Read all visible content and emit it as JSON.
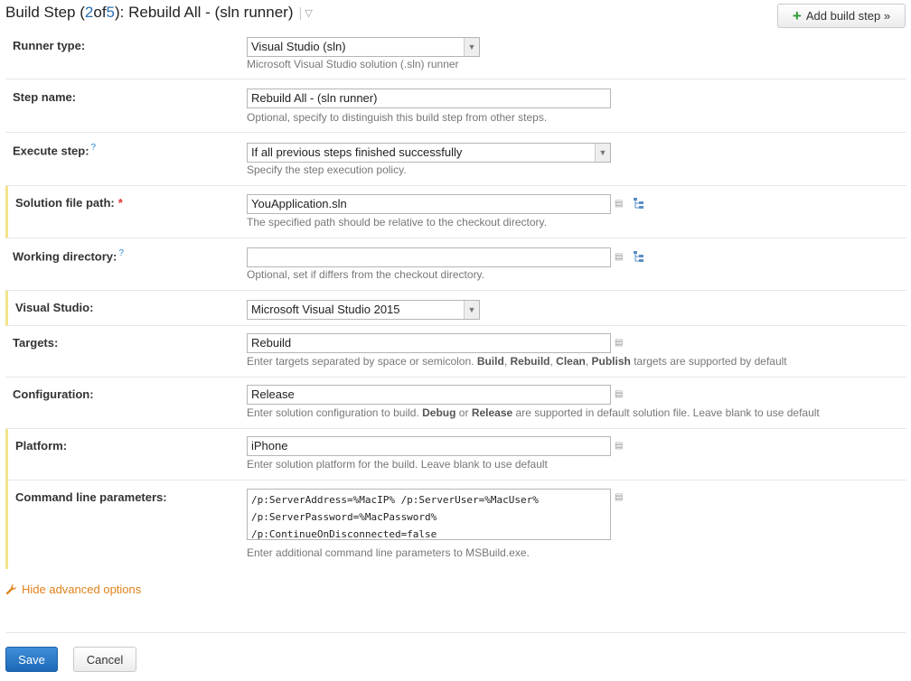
{
  "header": {
    "prefix": "Build Step (",
    "current": "2",
    "of": " of ",
    "total": "5",
    "suffix": "): Rebuild All - (sln runner)",
    "add_button": "Add build step »"
  },
  "fields": {
    "runner_type": {
      "label": "Runner type:",
      "value": "Visual Studio (sln)",
      "note": "Microsoft Visual Studio solution (.sln) runner"
    },
    "step_name": {
      "label": "Step name:",
      "value": "Rebuild All - (sln runner)",
      "note": "Optional, specify to distinguish this build step from other steps."
    },
    "execute_step": {
      "label": "Execute step:",
      "value": "If all previous steps finished successfully",
      "note": "Specify the step execution policy."
    },
    "solution_path": {
      "label": "Solution file path:",
      "required": "*",
      "value": "YouApplication.sln",
      "note": "The specified path should be relative to the checkout directory."
    },
    "working_dir": {
      "label": "Working directory:",
      "value": "",
      "note": "Optional, set if differs from the checkout directory."
    },
    "visual_studio": {
      "label": "Visual Studio:",
      "value": "Microsoft Visual Studio 2015"
    },
    "targets": {
      "label": "Targets:",
      "value": "Rebuild",
      "note_pre": "Enter targets separated by space or semicolon. ",
      "note_b1": "Build",
      "note_c1": ", ",
      "note_b2": "Rebuild",
      "note_c2": ", ",
      "note_b3": "Clean",
      "note_c3": ", ",
      "note_b4": "Publish",
      "note_post": " targets are supported by default"
    },
    "configuration": {
      "label": "Configuration:",
      "value": "Release",
      "note_pre": "Enter solution configuration to build. ",
      "note_b1": "Debug",
      "note_mid": " or ",
      "note_b2": "Release",
      "note_post": " are supported in default solution file. Leave blank to use default"
    },
    "platform": {
      "label": "Platform:",
      "value": "iPhone",
      "note": "Enter solution platform for the build. Leave blank to use default"
    },
    "cmdline": {
      "label": "Command line parameters:",
      "line1": "/p:ServerAddress=%MacIP% /p:ServerUser=%MacUser%",
      "line2": "/p:ServerPassword=%MacPassword%",
      "line3": "/p:ContinueOnDisconnected=false",
      "note": "Enter additional command line parameters to MSBuild.exe."
    }
  },
  "help_glyph": "?",
  "advanced_link": "Hide advanced options",
  "buttons": {
    "save": "Save",
    "cancel": "Cancel"
  },
  "colors": {
    "accent": "#2a6fb3",
    "advanced_border": "#f1e48a",
    "link": "#e0821b",
    "save": "#1d68b8"
  },
  "icons": [
    "add-icon",
    "dropdown-arrow-icon",
    "help-icon",
    "text-editor-icon",
    "vcs-tree-icon",
    "wrench-icon"
  ]
}
